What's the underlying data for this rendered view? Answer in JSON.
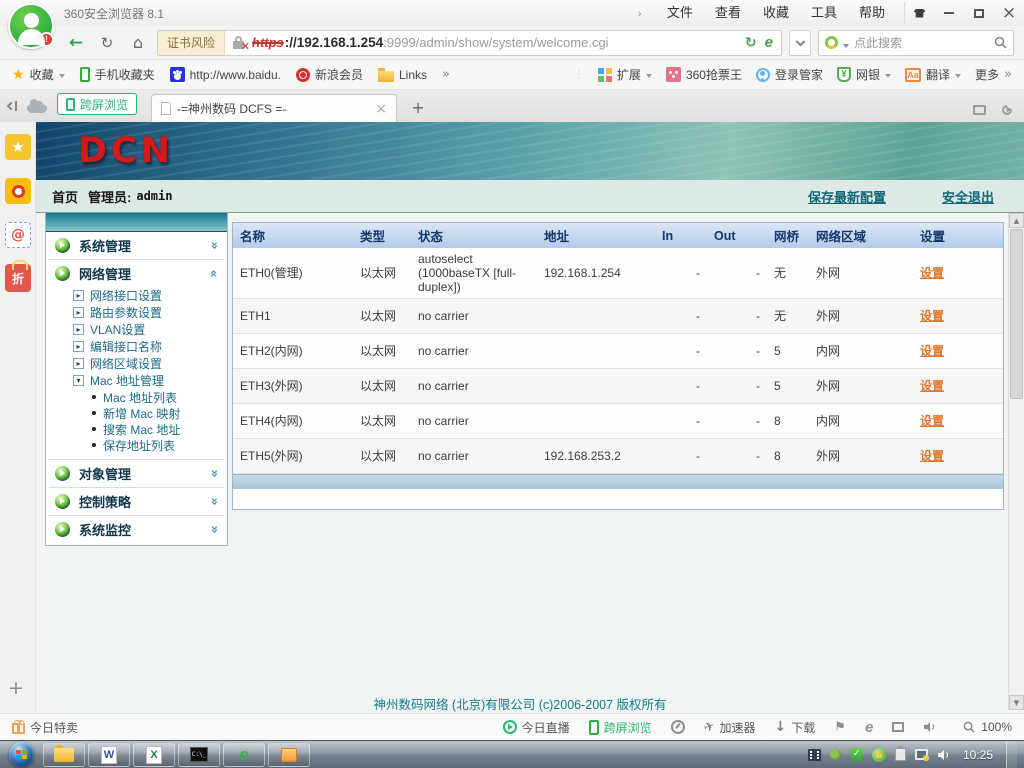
{
  "browser": {
    "window_title": "360安全浏览器 8.1",
    "menu_items": [
      "文件",
      "查看",
      "收藏",
      "工具",
      "帮助"
    ],
    "address": {
      "cert_warning": "证书风险",
      "protocol": "https",
      "host": "://192.168.1.254",
      "path": ":9999/admin/show/system/welcome.cgi"
    },
    "search_placeholder": "点此搜索",
    "bookmarks": {
      "fav_label": "收藏",
      "mobile_label": "手机收藏夹",
      "baidu_label": "http://www.baidu.",
      "sina_label": "新浪会员",
      "links_label": "Links",
      "ext_label": "扩展",
      "ticket_label": "360抢票王",
      "login_label": "登录管家",
      "bank_label": "网银",
      "translate_label": "翻译",
      "more_label": "更多"
    },
    "tabs": {
      "cross_screen_label": "跨屏浏览",
      "active_title": "-=神州数码 DCFS =-"
    },
    "statusbar": {
      "deals": "今日特卖",
      "live": "今日直播",
      "cross_screen": "跨屏浏览",
      "booster": "加速器",
      "download": "下载",
      "zoom": "100%"
    }
  },
  "page": {
    "logo_text": "DCN",
    "topbar": {
      "home": "首页",
      "admin_label": "管理员:",
      "admin_user": "admin",
      "save_config": "保存最新配置",
      "logout": "安全退出"
    },
    "sidebar": {
      "sections": [
        {
          "label": "系统管理"
        },
        {
          "label": "网络管理"
        },
        {
          "label": "对象管理"
        },
        {
          "label": "控制策略"
        },
        {
          "label": "系统监控"
        }
      ],
      "network_items": [
        "网络接口设置",
        "路由参数设置",
        "VLAN设置",
        "编辑接口名称",
        "网络区域设置",
        "Mac 地址管理"
      ],
      "mac_items": [
        "Mac 地址列表",
        "新增 Mac 映射",
        "搜索 Mac 地址",
        "保存地址列表"
      ]
    },
    "table": {
      "headers": [
        "名称",
        "类型",
        "状态",
        "地址",
        "In",
        "Out",
        "网桥",
        "网络区域",
        "设置"
      ],
      "rows": [
        {
          "name": "ETH0(管理)",
          "type": "以太网",
          "status": "autoselect (1000baseTX [full-duplex])",
          "address": "192.168.1.254",
          "in": "-",
          "out": "-",
          "bridge": "无",
          "zone": "外网",
          "action": "设置"
        },
        {
          "name": "ETH1",
          "type": "以太网",
          "status": "no carrier",
          "address": "",
          "in": "-",
          "out": "-",
          "bridge": "无",
          "zone": "外网",
          "action": "设置"
        },
        {
          "name": "ETH2(内网)",
          "type": "以太网",
          "status": "no carrier",
          "address": "",
          "in": "-",
          "out": "-",
          "bridge": "5",
          "zone": "内网",
          "action": "设置"
        },
        {
          "name": "ETH3(外网)",
          "type": "以太网",
          "status": "no carrier",
          "address": "",
          "in": "-",
          "out": "-",
          "bridge": "5",
          "zone": "外网",
          "action": "设置"
        },
        {
          "name": "ETH4(内网)",
          "type": "以太网",
          "status": "no carrier",
          "address": "",
          "in": "-",
          "out": "-",
          "bridge": "8",
          "zone": "内网",
          "action": "设置"
        },
        {
          "name": "ETH5(外网)",
          "type": "以太网",
          "status": "no carrier",
          "address": "192.168.253.2",
          "in": "-",
          "out": "-",
          "bridge": "8",
          "zone": "外网",
          "action": "设置"
        }
      ]
    },
    "footer": "神州数码网络 (北京)有限公司  (c)2006-2007  版权所有"
  },
  "taskbar": {
    "clock": "10:25"
  },
  "colors": {
    "logo_red": "#d31a1a",
    "accent_teal": "#157a8a",
    "table_header_blue": "#14386b",
    "action_link_orange": "#e0762a",
    "browser_green": "#2bb673"
  }
}
